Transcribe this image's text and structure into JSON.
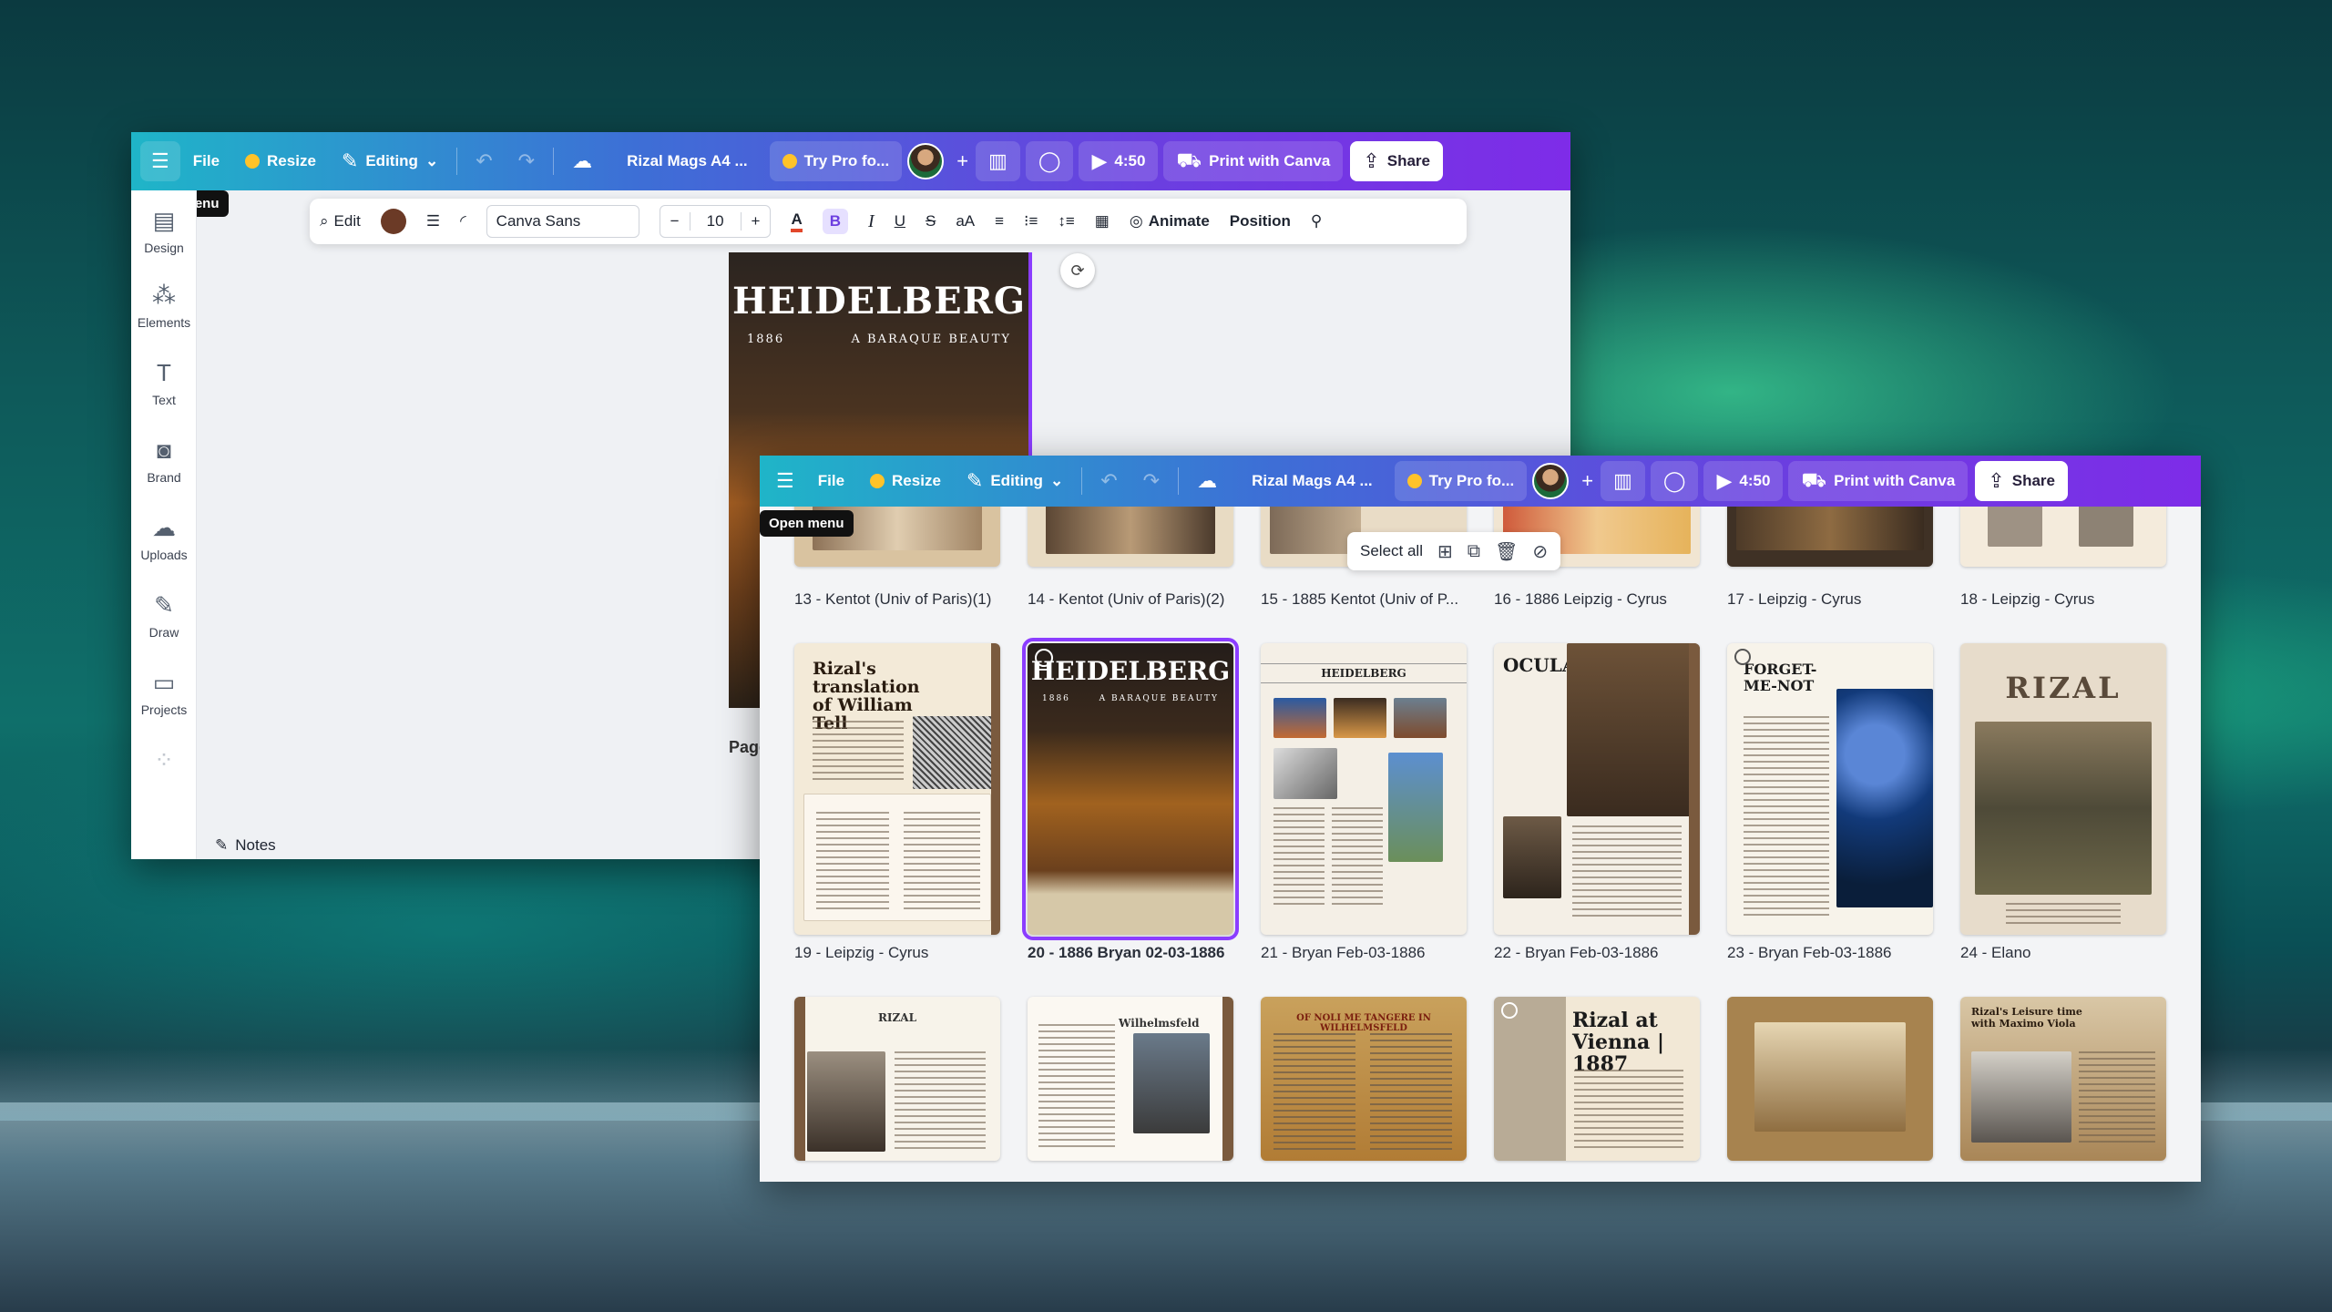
{
  "toolbar": {
    "file": "File",
    "resize": "Resize",
    "editing": "Editing",
    "doc_title": "Rizal Mags A4 ...",
    "try_pro": "Try Pro fo...",
    "timer": "4:50",
    "print": "Print with Canva",
    "share": "Share",
    "open_menu_tip": "Open menu"
  },
  "sidebar": {
    "items": [
      {
        "label": "Design",
        "icon": "design-icon"
      },
      {
        "label": "Elements",
        "icon": "elements-icon"
      },
      {
        "label": "Text",
        "icon": "text-icon"
      },
      {
        "label": "Brand",
        "icon": "brand-icon"
      },
      {
        "label": "Uploads",
        "icon": "uploads-icon"
      },
      {
        "label": "Draw",
        "icon": "draw-icon"
      },
      {
        "label": "Projects",
        "icon": "projects-icon"
      }
    ]
  },
  "context_toolbar": {
    "edit": "Edit",
    "font": "Canva Sans",
    "minus": "−",
    "font_size": "10",
    "plus": "+",
    "case": "aA",
    "animate": "Animate",
    "position": "Position",
    "color": "#6b3a26"
  },
  "canvas": {
    "cover_title": "HEIDELBERG",
    "cover_year": "1886",
    "cover_tagline": "A BARAQUE BEAUTY",
    "page_label": "Page",
    "notes": "Notes"
  },
  "multi_select": {
    "select_all": "Select all"
  },
  "pages": [
    {
      "label": "13 - Kentot (Univ of Paris)(1)"
    },
    {
      "label": "14 - Kentot (Univ of Paris)(2)"
    },
    {
      "label": "15 - 1885 Kentot (Univ of P..."
    },
    {
      "label": "16 - 1886 Leipzig - Cyrus"
    },
    {
      "label": "17 - Leipzig - Cyrus"
    },
    {
      "label": "18 - Leipzig - Cyrus"
    },
    {
      "label": "19 - Leipzig - Cyrus",
      "heading": "Rizal's translation of William Tell"
    },
    {
      "label": "20 - 1886 Bryan 02-03-1886",
      "heading": "HEIDELBERG",
      "selected": true
    },
    {
      "label": "21 - Bryan Feb-03-1886",
      "heading": "HEIDELBERG"
    },
    {
      "label": "22 - Bryan Feb-03-1886",
      "heading": "OCULAR WISDOM"
    },
    {
      "label": "23 - Bryan Feb-03-1886",
      "heading": "FORGET-ME-NOT"
    },
    {
      "label": "24 - Elano",
      "heading": "RIZAL"
    },
    {
      "heading": "RIZAL"
    },
    {
      "heading": "Wilhelmsfeld"
    },
    {
      "heading": "OF NOLI ME TANGERE IN WILHELMSFELD"
    },
    {
      "heading": "Rizal at Vienna | 1887"
    },
    {
      "heading": ""
    },
    {
      "heading": "Rizal's Leisure time with Maximo Viola"
    }
  ],
  "colors": {
    "accent": "#8b3dff",
    "gradient_start": "#1fb5c8",
    "gradient_end": "#7e2ce8"
  }
}
